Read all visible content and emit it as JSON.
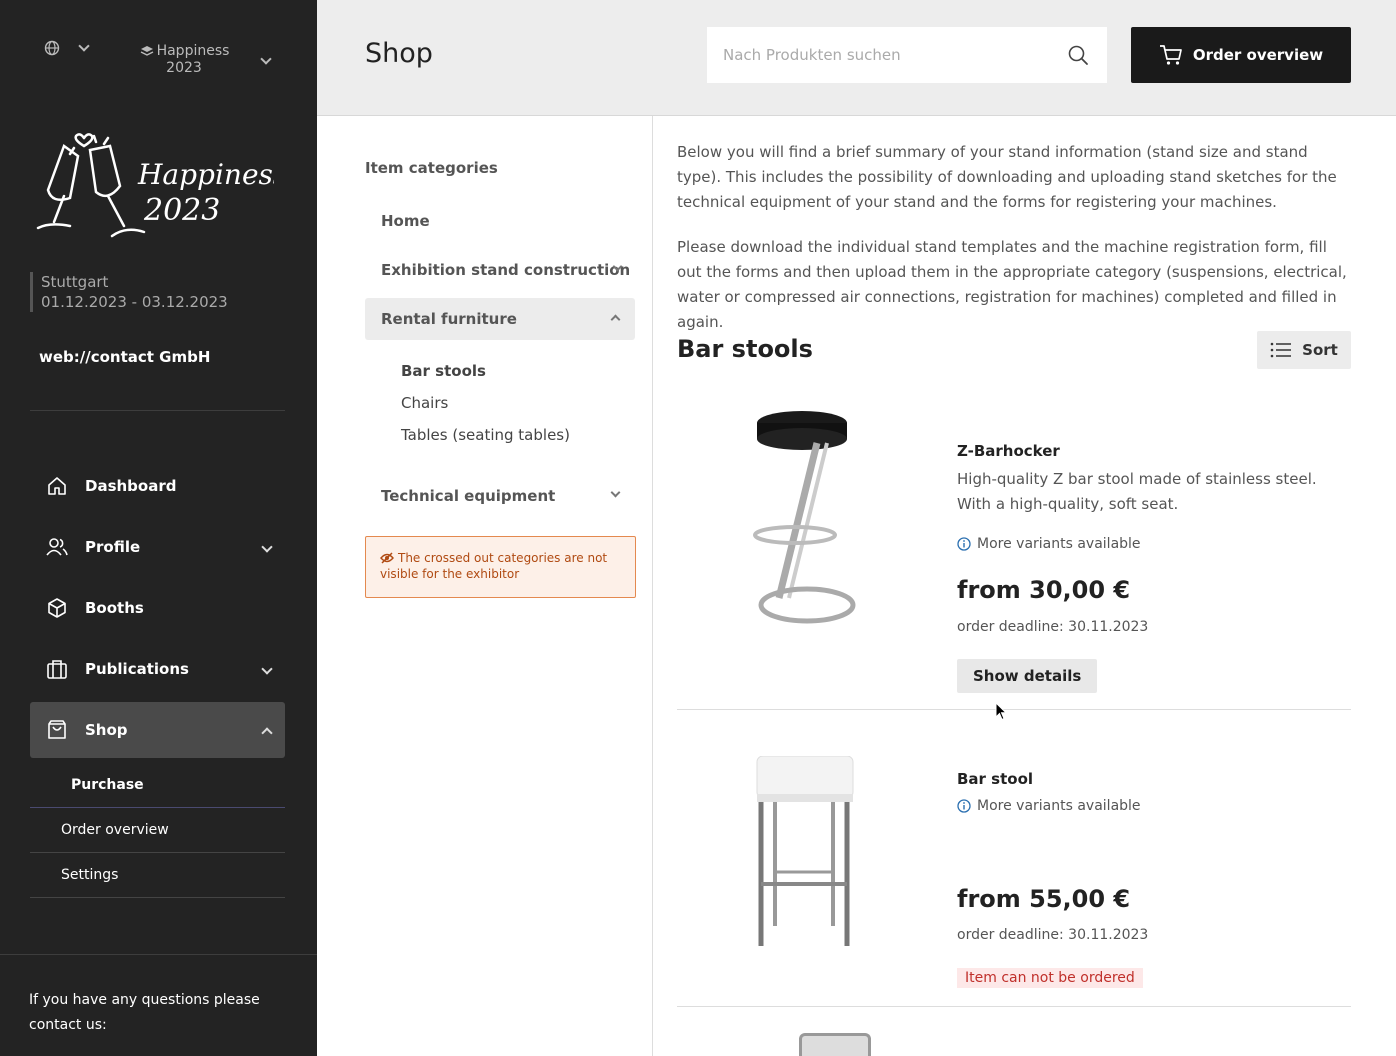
{
  "sidebar": {
    "event_name": "Happiness 2023",
    "location": "Stuttgart",
    "dates": "01.12.2023 - 03.12.2023",
    "company": "web://contact GmbH",
    "nav": [
      {
        "label": "Dashboard",
        "icon": "home-icon"
      },
      {
        "label": "Profile",
        "icon": "users-icon"
      },
      {
        "label": "Booths",
        "icon": "cube-icon"
      },
      {
        "label": "Publications",
        "icon": "briefcase-icon"
      },
      {
        "label": "Shop",
        "icon": "shopping-bag-icon"
      }
    ],
    "shop_sub": [
      "Purchase",
      "Order overview",
      "Settings"
    ],
    "help_text": "If you have any questions please contact us:"
  },
  "header": {
    "title": "Shop",
    "search_placeholder": "Nach Produkten suchen",
    "order_button": "Order overview"
  },
  "categories": {
    "title": "Item categories",
    "items": [
      "Home",
      "Exhibition stand construction",
      "Rental furniture",
      "Technical equipment"
    ],
    "sub_items": [
      "Bar stools",
      "Chairs",
      "Tables (seating tables)"
    ],
    "notice": "The crossed out categories are not visible for the exhibitor"
  },
  "main": {
    "intro1": "Below you will find a brief summary of your stand information (stand size and stand type). This includes the possibility of downloading and uploading stand sketches for the technical equipment of your stand and the forms for registering your machines.",
    "intro2": "Please download the individual stand templates and the machine registration form, fill out the forms and then upload them in the appropriate category (suspensions, electrical, water or compressed air connections, registration for machines) completed and filled in again.",
    "section_title": "Bar stools",
    "sort_label": "Sort",
    "products": [
      {
        "name": "Z-Barhocker",
        "desc": "High-quality Z bar stool made of stainless steel. With a high-quality, soft seat.",
        "variants": "More variants available",
        "price": "from 30,00 €",
        "deadline": "order deadline: 30.11.2023",
        "action": "Show details"
      },
      {
        "name": "Bar stool",
        "variants": "More variants available",
        "price": "from 55,00 €",
        "deadline": "order deadline: 30.11.2023",
        "status": "Item can not be ordered"
      }
    ]
  },
  "colors": {
    "sidebar_bg": "#232323",
    "accent_dark": "#1a1a1a",
    "notice_border": "#e4894f",
    "error_text": "#c0302b"
  }
}
